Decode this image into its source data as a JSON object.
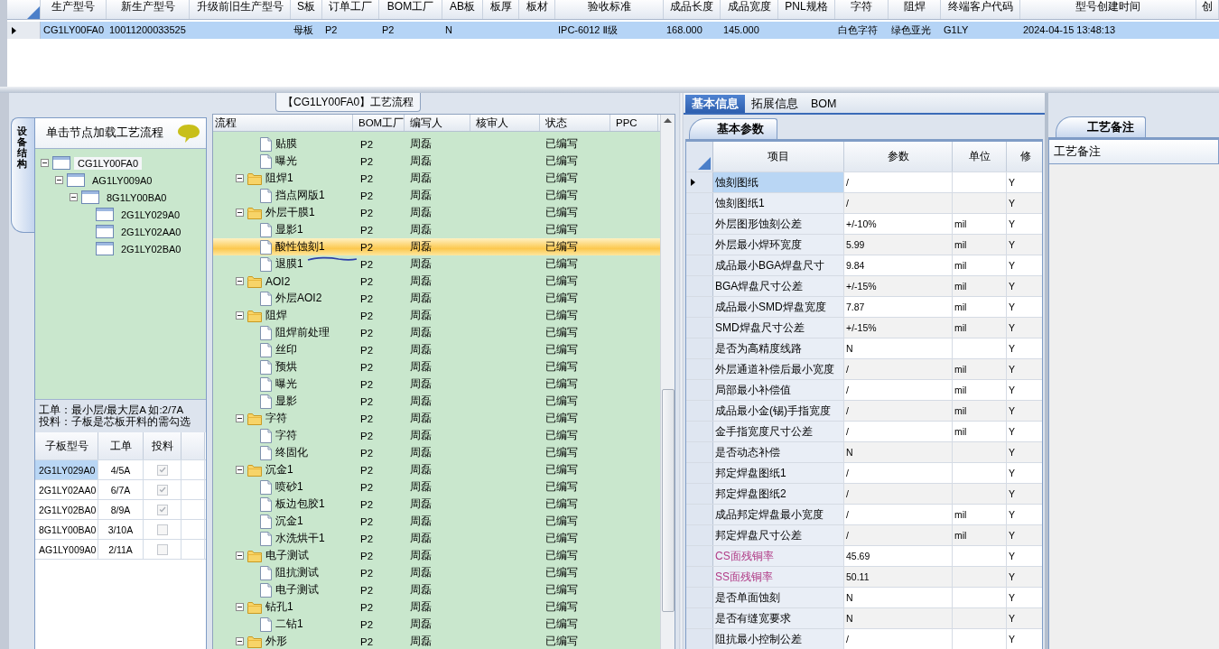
{
  "top_table": {
    "row_selected": true,
    "columns": [
      {
        "label": "生产型号",
        "value": "CG1LY00FA0"
      },
      {
        "label": "新生产型号",
        "value": "10011200033525"
      },
      {
        "label": "升级前旧生产型号"
      },
      {
        "label": "S板",
        "value": "母板"
      },
      {
        "label": "订单工厂",
        "value": "P2"
      },
      {
        "label": "BOM工厂",
        "value": "P2"
      },
      {
        "label": "AB板",
        "value": "N"
      },
      {
        "label": "板厚"
      },
      {
        "label": "板材"
      },
      {
        "label": "验收标准",
        "value": "IPC-6012 Ⅱ级"
      },
      {
        "label": "成品长度",
        "value": "168.000"
      },
      {
        "label": "成品宽度",
        "value": "145.000"
      },
      {
        "label": "PNL规格"
      },
      {
        "label": "字符",
        "value": "白色字符"
      },
      {
        "label": "阻焊",
        "value": "绿色亚光"
      },
      {
        "label": "终端客户代码",
        "value": "G1LY"
      },
      {
        "label": "型号创建时间",
        "value": "2024-04-15 13:48:13"
      },
      {
        "label": "创"
      }
    ]
  },
  "left_panel": {
    "side_tab": "设备结构",
    "header": "单击节点加载工艺流程",
    "tree": [
      {
        "label": "CG1LY00FA0",
        "selected": true,
        "expanded": true,
        "children": [
          {
            "label": "AG1LY009A0",
            "selected": false,
            "expanded": true,
            "children": [
              {
                "label": "8G1LY00BA0",
                "selected": false,
                "expanded": true,
                "children": [
                  {
                    "label": "2G1LY029A0",
                    "selected": false
                  },
                  {
                    "label": "2G1LY02AA0",
                    "selected": false
                  },
                  {
                    "label": "2G1LY02BA0",
                    "selected": false
                  }
                ]
              }
            ]
          }
        ]
      }
    ],
    "notes": [
      "工单：最小层/最大层A 如:2/7A",
      "投料：子板是芯板开料的需勾选"
    ],
    "table": {
      "columns": [
        "子板型号",
        "工单",
        "投料"
      ],
      "rows": [
        {
          "board": "2G1LY029A0",
          "order": "4/5A",
          "checked": true,
          "selected": true
        },
        {
          "board": "2G1LY02AA0",
          "order": "6/7A",
          "checked": true,
          "selected": false
        },
        {
          "board": "2G1LY02BA0",
          "order": "8/9A",
          "checked": true,
          "selected": false
        },
        {
          "board": "8G1LY00BA0",
          "order": "3/10A",
          "checked": false,
          "selected": false
        },
        {
          "board": "AG1LY009A0",
          "order": "2/11A",
          "checked": false,
          "selected": false
        }
      ]
    }
  },
  "flow": {
    "title": "【CG1LY00FA0】工艺流程",
    "columns": [
      "流程",
      "BOM工厂",
      "编写人",
      "核审人",
      "状态",
      "PPC"
    ],
    "steps": [
      {
        "kind": "continued",
        "children": [
          {
            "kind": "step",
            "name": "贴膜",
            "factory": "P2",
            "writer": "周磊",
            "status": "已编写",
            "selected": false
          },
          {
            "kind": "step",
            "name": "曝光",
            "factory": "P2",
            "writer": "周磊",
            "status": "已编写",
            "selected": false
          }
        ]
      },
      {
        "kind": "folder",
        "name": "阻焊1",
        "factory": "P2",
        "writer": "周磊",
        "status": "已编写",
        "selected": false,
        "expanded": true,
        "children": [
          {
            "kind": "step",
            "name": "挡点网版1",
            "factory": "P2",
            "writer": "周磊",
            "status": "已编写",
            "selected": false
          }
        ]
      },
      {
        "kind": "folder",
        "name": "外层干膜1",
        "factory": "P2",
        "writer": "周磊",
        "status": "已编写",
        "selected": false,
        "expanded": true,
        "children": [
          {
            "kind": "step",
            "name": "显影1",
            "factory": "P2",
            "writer": "周磊",
            "status": "已编写",
            "selected": false
          },
          {
            "kind": "step",
            "name": "酸性蚀刻1",
            "factory": "P2",
            "writer": "周磊",
            "status": "已编写",
            "selected": true
          },
          {
            "kind": "step",
            "name": "退膜1",
            "factory": "P2",
            "writer": "周磊",
            "status": "已编写",
            "selected": false
          }
        ]
      },
      {
        "kind": "folder",
        "name": "AOI2",
        "factory": "P2",
        "writer": "周磊",
        "status": "已编写",
        "selected": false,
        "expanded": true,
        "children": [
          {
            "kind": "step",
            "name": "外层AOI2",
            "factory": "P2",
            "writer": "周磊",
            "status": "已编写",
            "selected": false
          }
        ]
      },
      {
        "kind": "folder",
        "name": "阻焊",
        "factory": "P2",
        "writer": "周磊",
        "status": "已编写",
        "selected": false,
        "expanded": true,
        "children": [
          {
            "kind": "step",
            "name": "阻焊前处理",
            "factory": "P2",
            "writer": "周磊",
            "status": "已编写",
            "selected": false
          },
          {
            "kind": "step",
            "name": "丝印",
            "factory": "P2",
            "writer": "周磊",
            "status": "已编写",
            "selected": false
          },
          {
            "kind": "step",
            "name": "预烘",
            "factory": "P2",
            "writer": "周磊",
            "status": "已编写",
            "selected": false
          },
          {
            "kind": "step",
            "name": "曝光",
            "factory": "P2",
            "writer": "周磊",
            "status": "已编写",
            "selected": false
          },
          {
            "kind": "step",
            "name": "显影",
            "factory": "P2",
            "writer": "周磊",
            "status": "已编写",
            "selected": false
          }
        ]
      },
      {
        "kind": "folder",
        "name": "字符",
        "factory": "P2",
        "writer": "周磊",
        "status": "已编写",
        "selected": false,
        "expanded": true,
        "children": [
          {
            "kind": "step",
            "name": "字符",
            "factory": "P2",
            "writer": "周磊",
            "status": "已编写",
            "selected": false
          },
          {
            "kind": "step",
            "name": "终固化",
            "factory": "P2",
            "writer": "周磊",
            "status": "已编写",
            "selected": false
          }
        ]
      },
      {
        "kind": "folder",
        "name": "沉金1",
        "factory": "P2",
        "writer": "周磊",
        "status": "已编写",
        "selected": false,
        "expanded": true,
        "children": [
          {
            "kind": "step",
            "name": "喷砂1",
            "factory": "P2",
            "writer": "周磊",
            "status": "已编写",
            "selected": false
          },
          {
            "kind": "step",
            "name": "板边包胶1",
            "factory": "P2",
            "writer": "周磊",
            "status": "已编写",
            "selected": false
          },
          {
            "kind": "step",
            "name": "沉金1",
            "factory": "P2",
            "writer": "周磊",
            "status": "已编写",
            "selected": false
          },
          {
            "kind": "step",
            "name": "水洗烘干1",
            "factory": "P2",
            "writer": "周磊",
            "status": "已编写",
            "selected": false
          }
        ]
      },
      {
        "kind": "folder",
        "name": "电子测试",
        "factory": "P2",
        "writer": "周磊",
        "status": "已编写",
        "selected": false,
        "expanded": true,
        "children": [
          {
            "kind": "step",
            "name": "阻抗测试",
            "factory": "P2",
            "writer": "周磊",
            "status": "已编写",
            "selected": false
          },
          {
            "kind": "step",
            "name": "电子测试",
            "factory": "P2",
            "writer": "周磊",
            "status": "已编写",
            "selected": false
          }
        ]
      },
      {
        "kind": "folder",
        "name": "钻孔1",
        "factory": "P2",
        "writer": "周磊",
        "status": "已编写",
        "selected": false,
        "expanded": true,
        "children": [
          {
            "kind": "step",
            "name": "二钻1",
            "factory": "P2",
            "writer": "周磊",
            "status": "已编写",
            "selected": false
          }
        ]
      },
      {
        "kind": "folder",
        "name": "外形",
        "factory": "P2",
        "writer": "周磊",
        "status": "已编写",
        "selected": false,
        "expanded": true
      }
    ]
  },
  "info_panel": {
    "tabs": [
      {
        "label": "基本信息",
        "selected": true
      },
      {
        "label": "拓展信息",
        "selected": false
      },
      {
        "label": "BOM",
        "selected": false
      }
    ],
    "sub_tab": "基本参数",
    "columns": [
      "项目",
      "参数",
      "单位",
      "修"
    ],
    "rows": [
      {
        "item": "蚀刻图纸",
        "value": "/",
        "modified": "Y",
        "selected": true
      },
      {
        "item": "蚀刻图纸1",
        "value": "/",
        "modified": "Y",
        "selected": false
      },
      {
        "item": "外层图形蚀刻公差",
        "value": "+/-10%",
        "unit": "mil",
        "modified": "Y",
        "selected": false
      },
      {
        "item": "外层最小焊环宽度",
        "value": "5.99",
        "unit": "mil",
        "modified": "Y",
        "selected": false
      },
      {
        "item": "成品最小BGA焊盘尺寸",
        "value": "9.84",
        "unit": "mil",
        "modified": "Y",
        "selected": false
      },
      {
        "item": "BGA焊盘尺寸公差",
        "value": "+/-15%",
        "unit": "mil",
        "modified": "Y",
        "selected": false
      },
      {
        "item": "成品最小SMD焊盘宽度",
        "value": "7.87",
        "unit": "mil",
        "modified": "Y",
        "selected": false
      },
      {
        "item": "SMD焊盘尺寸公差",
        "value": "+/-15%",
        "unit": "mil",
        "modified": "Y",
        "selected": false
      },
      {
        "item": "是否为高精度线路",
        "value": "N",
        "modified": "Y",
        "selected": false
      },
      {
        "item": "外层通道补偿后最小宽度",
        "value": "/",
        "unit": "mil",
        "modified": "Y",
        "selected": false
      },
      {
        "item": "局部最小补偿值",
        "value": "/",
        "unit": "mil",
        "modified": "Y",
        "selected": false
      },
      {
        "item": "成品最小金(锡)手指宽度",
        "value": "/",
        "unit": "mil",
        "modified": "Y",
        "selected": false
      },
      {
        "item": "金手指宽度尺寸公差",
        "value": "/",
        "unit": "mil",
        "modified": "Y",
        "selected": false
      },
      {
        "item": "是否动态补偿",
        "value": "N",
        "modified": "Y",
        "selected": false
      },
      {
        "item": "邦定焊盘图纸1",
        "value": "/",
        "modified": "Y",
        "selected": false
      },
      {
        "item": "邦定焊盘图纸2",
        "value": "/",
        "modified": "Y",
        "selected": false
      },
      {
        "item": "成品邦定焊盘最小宽度",
        "value": "/",
        "unit": "mil",
        "modified": "Y",
        "selected": false
      },
      {
        "item": "邦定焊盘尺寸公差",
        "value": "/",
        "unit": "mil",
        "modified": "Y",
        "selected": false
      },
      {
        "item": "CS面残铜率",
        "value": "45.69",
        "modified": "Y",
        "selected": false,
        "color": "#b03a86"
      },
      {
        "item": "SS面残铜率",
        "value": "50.11",
        "modified": "Y",
        "selected": false,
        "color": "#b03a86"
      },
      {
        "item": "是否单面蚀刻",
        "value": "N",
        "modified": "Y",
        "selected": false
      },
      {
        "item": "是否有缝宽要求",
        "value": "N",
        "modified": "Y",
        "selected": false
      },
      {
        "item": "阻抗最小控制公差",
        "value": "/",
        "modified": "Y",
        "selected": false
      }
    ]
  },
  "notes_panel": {
    "tab": "工艺备注",
    "header": "工艺备注"
  }
}
